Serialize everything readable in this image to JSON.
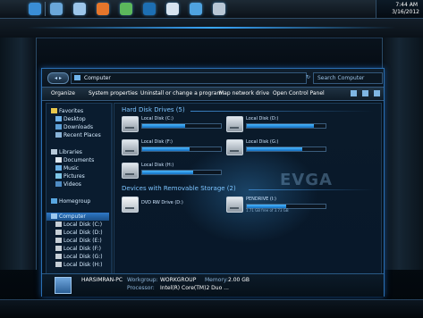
{
  "dock": {
    "items": [
      {
        "name": "globe-icon",
        "color": "#3a8ed6"
      },
      {
        "name": "folder-icon",
        "color": "#6aa7d9"
      },
      {
        "name": "back-arrow-icon",
        "color": "#9cc6ea"
      },
      {
        "name": "firefox-icon",
        "color": "#e5762b"
      },
      {
        "name": "swirl-icon",
        "color": "#5cb85c"
      },
      {
        "name": "photoshop-icon",
        "color": "#1d6fb3"
      },
      {
        "name": "person-icon",
        "color": "#d7e4f0"
      },
      {
        "name": "cross-tools-icon",
        "color": "#4fa3e0"
      },
      {
        "name": "monitor-icon",
        "color": "#b8c6d4"
      }
    ]
  },
  "clock": {
    "time": "7:44 AM",
    "date": "3/16/2012"
  },
  "window": {
    "address": "Computer",
    "search_placeholder": "Search Computer",
    "toolbar": [
      "Organize",
      "System properties",
      "Uninstall or change a program",
      "Map network drive",
      "Open Control Panel"
    ],
    "nav": {
      "favorites": [
        "Favorites",
        "Desktop",
        "Downloads",
        "Recent Places"
      ],
      "libraries": [
        "Libraries",
        "Documents",
        "Music",
        "Pictures",
        "Videos"
      ],
      "homegroup": "Homegroup",
      "computer": [
        "Computer",
        "Local Disk (C:)",
        "Local Disk (D:)",
        "Local Disk (E:)",
        "Local Disk (F:)",
        "Local Disk (G:)",
        "Local Disk (H:)"
      ]
    },
    "content": {
      "hdd_header": "Hard Disk Drives (5)",
      "drives": [
        {
          "name": "Local Disk (C:)",
          "fill": 0.55
        },
        {
          "name": "Local Disk (D:)",
          "fill": 0.85
        },
        {
          "name": "Local Disk (F:)",
          "fill": 0.6
        },
        {
          "name": "Local Disk (G:)",
          "fill": 0.7
        },
        {
          "name": "Local Disk (H:)",
          "fill": 0.65
        }
      ],
      "removable_header": "Devices with Removable Storage (2)",
      "removable": [
        {
          "name": "DVD RW Drive (D:)",
          "sub": ""
        },
        {
          "name": "PENDRIVE (I:)",
          "sub": "1.71 GB free of 3.73 GB",
          "fill": 0.5
        }
      ],
      "watermark": "EVGA"
    },
    "details": {
      "computer_name": "HARSIMRAN-PC",
      "workgroup_label": "Workgroup:",
      "workgroup": "WORKGROUP",
      "memory_label": "Memory:",
      "memory": "2.00 GB",
      "processor_label": "Processor:",
      "processor": "Intel(R) Core(TM)2 Duo ..."
    }
  }
}
